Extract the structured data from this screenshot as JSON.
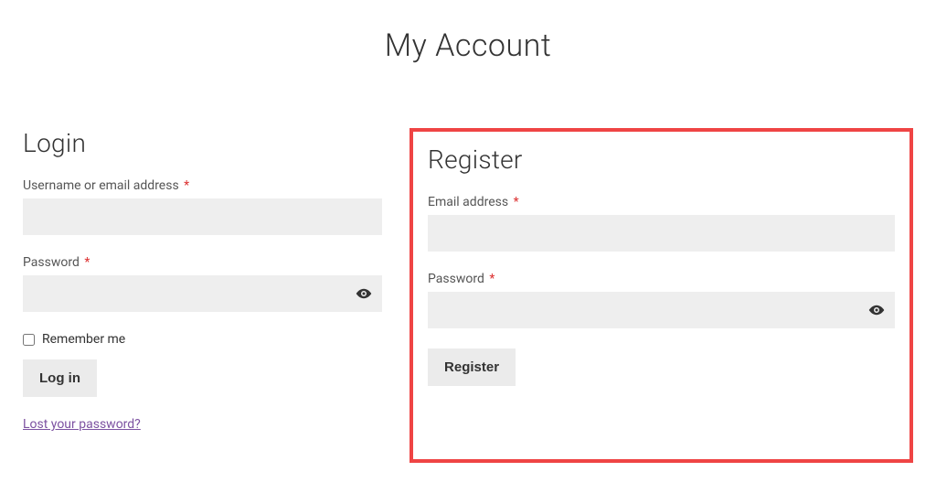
{
  "page_title": "My Account",
  "required_mark": "*",
  "login": {
    "heading": "Login",
    "username_label": "Username or email address",
    "password_label": "Password",
    "remember_label": "Remember me",
    "submit_label": "Log in",
    "lost_password_label": "Lost your password?",
    "username_value": "",
    "password_value": ""
  },
  "register": {
    "heading": "Register",
    "email_label": "Email address",
    "password_label": "Password",
    "submit_label": "Register",
    "email_value": "",
    "password_value": ""
  }
}
